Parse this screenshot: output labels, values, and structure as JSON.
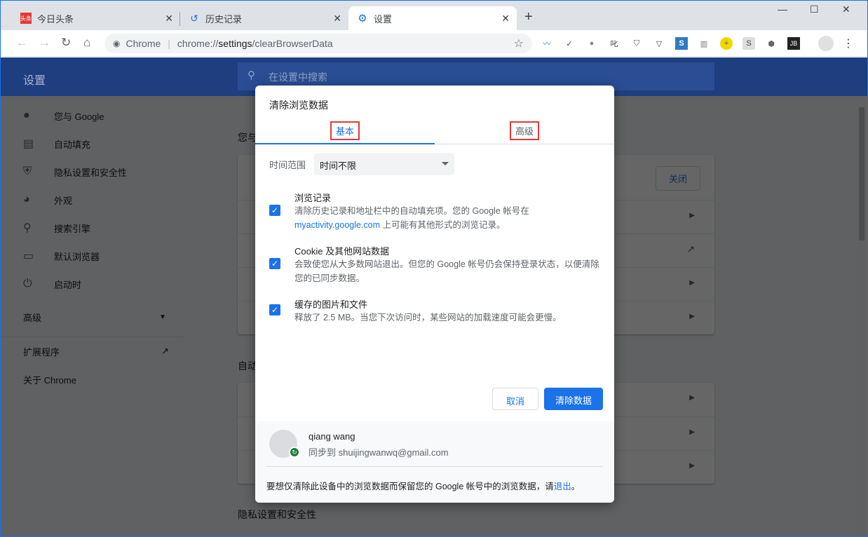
{
  "tabs": [
    {
      "label": "今日头条",
      "favicon": "toutiao-icon"
    },
    {
      "label": "历史记录",
      "favicon": "history-icon"
    },
    {
      "label": "设置",
      "favicon": "gear-icon",
      "active": true
    }
  ],
  "omnibox": {
    "site": "Chrome",
    "url_prefix": "chrome://",
    "url_host": "settings",
    "url_path": "/clearBrowserData"
  },
  "extensions": [
    "trend-icon",
    "ext-2-icon",
    "ext-3-icon",
    "ext-4-icon",
    "shield-icon",
    "shield-check-icon",
    "s-blue-icon",
    "tt-icon",
    "plus-circle-icon",
    "s-gray-icon",
    "hex-icon",
    "jb-icon"
  ],
  "settings": {
    "title": "设置",
    "search_placeholder": "在设置中搜索",
    "sidebar": [
      {
        "label": "您与 Google",
        "icon": "person-icon"
      },
      {
        "label": "自动填充",
        "icon": "clipboard-icon"
      },
      {
        "label": "隐私设置和安全性",
        "icon": "shield-icon"
      },
      {
        "label": "外观",
        "icon": "palette-icon"
      },
      {
        "label": "搜索引擎",
        "icon": "search-icon"
      },
      {
        "label": "默认浏览器",
        "icon": "browser-icon"
      },
      {
        "label": "启动时",
        "icon": "power-icon"
      }
    ],
    "advanced": "高级",
    "extensions": "扩展程序",
    "about": "关于 Chrome",
    "sections": {
      "you": "您与",
      "autofill": "自动",
      "privacy": "隐私设置和安全性"
    },
    "close_button": "关闭"
  },
  "dialog": {
    "title": "清除浏览数据",
    "tabs": [
      "基本",
      "高级"
    ],
    "time_range_label": "时间范围",
    "time_range_value": "时间不限",
    "items": [
      {
        "title": "浏览记录",
        "desc1": "清除历史记录和地址栏中的自动填充项。您的 Google 帐号在",
        "link": "myactivity.google.com",
        "desc2": " 上可能有其他形式的浏览记录。",
        "checked": true
      },
      {
        "title": "Cookie 及其他网站数据",
        "desc1": "会致使您从大多数网站退出。但您的 Google 帐号仍会保持登录状态，以便清除您的已同步数据。",
        "checked": true
      },
      {
        "title": "缓存的图片和文件",
        "desc1": "释放了 2.5 MB。当您下次访问时，某些网站的加载速度可能会更慢。",
        "checked": true
      }
    ],
    "cancel": "取消",
    "confirm": "清除数据",
    "account": {
      "name": "qiang wang",
      "sync": "同步到 shuijingwanwq@gmail.com"
    },
    "footer_text": "要想仅清除此设备中的浏览数据而保留您的 Google 帐号中的浏览数据，请",
    "footer_link": "退出",
    "footer_end": "。"
  }
}
